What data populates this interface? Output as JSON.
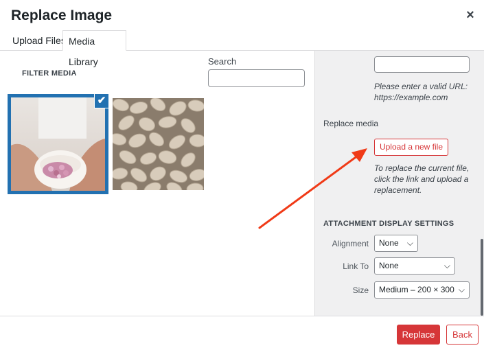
{
  "modal": {
    "title": "Replace Image",
    "close_icon": "×"
  },
  "tabs": [
    {
      "label": "Upload Files"
    },
    {
      "label": "Media Library"
    }
  ],
  "filter": {
    "label": "FILTER MEDIA",
    "search_label": "Search",
    "search_value": ""
  },
  "media": {
    "items": [
      {
        "description": "hands holding bowl of chopped onion",
        "selected": true
      },
      {
        "description": "rolled oats"
      }
    ],
    "check_icon": "✔"
  },
  "sidebar": {
    "url_value": "",
    "url_help": "Please enter a valid URL: https://example.com",
    "replace_media_label": "Replace media",
    "upload_button": "Upload a new file",
    "replace_help": "To replace the current file, click the link and upload a replacement.",
    "display_heading": "ATTACHMENT DISPLAY SETTINGS",
    "alignment": {
      "label": "Alignment",
      "value": "None"
    },
    "link_to": {
      "label": "Link To",
      "value": "None"
    },
    "size": {
      "label": "Size",
      "value": "Medium – 200 × 300"
    },
    "chevron": "⌵"
  },
  "footer": {
    "replace_button": "Replace",
    "back_button": "Back"
  },
  "colors": {
    "accent": "#2271b1",
    "danger": "#d63638",
    "annotation_arrow": "#f03a17"
  }
}
